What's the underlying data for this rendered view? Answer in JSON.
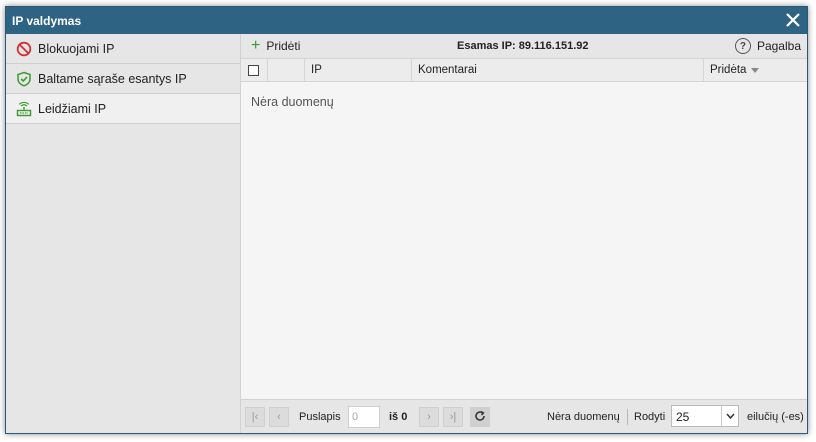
{
  "window": {
    "title": "IP valdymas",
    "close_icon": "close-icon"
  },
  "sidebar": {
    "items": [
      {
        "label": "Blokuojami IP",
        "icon": "block-icon",
        "color": "#d32f2f"
      },
      {
        "label": "Baltame sąraše esantys IP",
        "icon": "shield-check-icon",
        "color": "#3a9a2e"
      },
      {
        "label": "Leidžiami IP",
        "icon": "network-icon",
        "color": "#3a9a2e",
        "active": true
      }
    ]
  },
  "toolbar": {
    "add_label": "Pridėti",
    "current_ip": "Esamas IP: 89.116.151.92",
    "help_label": "Pagalba"
  },
  "grid": {
    "columns": [
      "IP",
      "Komentarai",
      "Pridėta"
    ],
    "sorted_column": "Pridėta",
    "empty_message": "Nėra duomenų"
  },
  "pager": {
    "page_label": "Puslapis",
    "page_value": "0",
    "of_label": "iš 0",
    "status": "Nėra duomenų",
    "show_label": "Rodyti",
    "page_size": "25",
    "rows_label": "eilučių (-es)"
  },
  "colors": {
    "titlebar": "#2f6384",
    "accent_green": "#3a9a2e",
    "block_red": "#d32f2f"
  }
}
